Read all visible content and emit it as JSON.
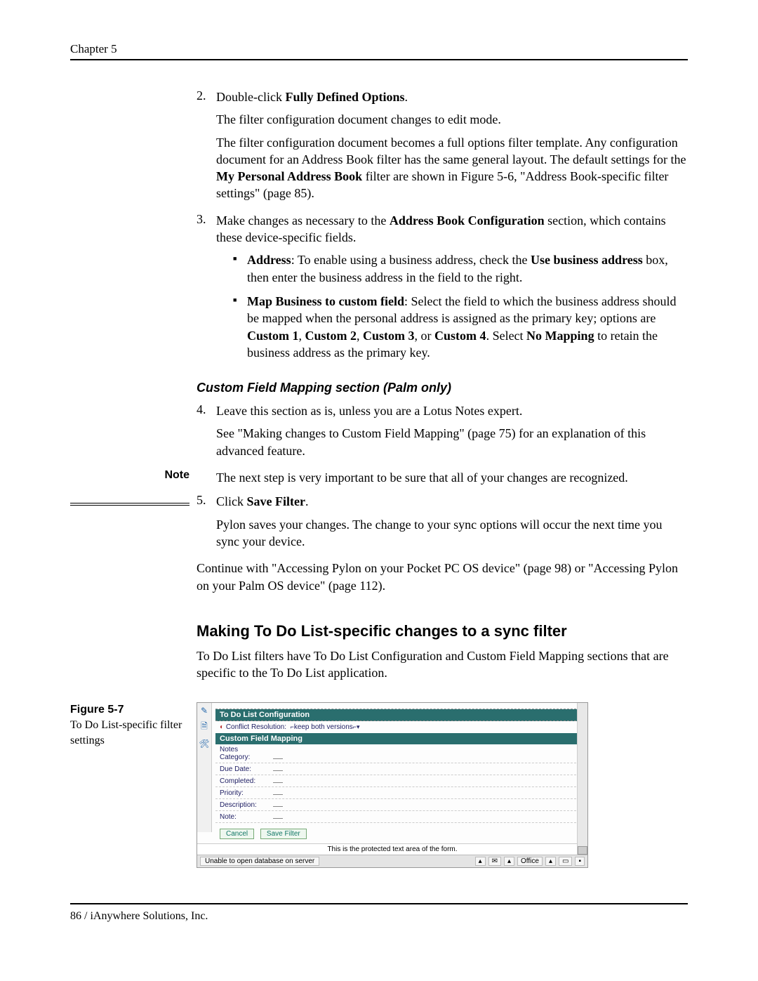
{
  "header": {
    "chapter": "Chapter 5"
  },
  "steps": {
    "s2": {
      "num": "2.",
      "line1a": "Double-click ",
      "line1b": "Fully Defined Options",
      "line1c": ".",
      "p1": "The filter configuration document changes to edit mode.",
      "p2a": "The filter configuration document becomes a full options filter template. Any configuration document for an Address Book filter has the same general layout. The default settings for the ",
      "p2b": "My Personal Address Book",
      "p2c": " filter are shown in Figure 5-6, \"Address Book-specific filter settings\" (page 85)."
    },
    "s3": {
      "num": "3.",
      "line1a": "Make changes as necessary to the ",
      "line1b": "Address Book Configuration",
      "line1c": " section, which contains these device-specific fields.",
      "b1_a": "Address",
      "b1_b": ": To enable using a business address, check the ",
      "b1_c": "Use business address",
      "b1_d": " box, then enter the business address in the field to the right.",
      "b2_a": "Map Business to custom field",
      "b2_b": ": Select the field to which the business address should be mapped when the personal address is assigned as the primary key; options are ",
      "b2_c": "Custom 1",
      "b2_d": ", ",
      "b2_e": "Custom 2",
      "b2_f": ", ",
      "b2_g": "Custom 3",
      "b2_h": ", or ",
      "b2_i": "Custom 4",
      "b2_j": ". Select ",
      "b2_k": "No Mapping",
      "b2_l": " to retain the business address as the primary key."
    },
    "subhead": "Custom Field Mapping section (Palm only)",
    "s4": {
      "num": "4.",
      "line1": "Leave this section as is, unless you are a Lotus Notes expert.",
      "p1": "See \"Making changes to Custom Field Mapping\" (page 75) for an explanation of this advanced feature."
    },
    "note": {
      "label": "Note",
      "text": "The next step is very important to be sure that all of your changes are recognized."
    },
    "s5": {
      "num": "5.",
      "line1a": "Click ",
      "line1b": "Save Filter",
      "line1c": ".",
      "p1": "Pylon saves your changes. The change to your sync options will occur the next time you sync your device."
    },
    "continue": "Continue with \"Accessing Pylon on your Pocket PC OS device\" (page 98) or \"Accessing Pylon on your Palm OS device\" (page 112)."
  },
  "section2": {
    "heading": "Making To Do List-specific changes to a sync filter",
    "intro": "To Do List filters have To Do List Configuration and Custom Field Mapping sections that are specific to the To Do List application."
  },
  "figure": {
    "label": "Figure 5-7",
    "caption": "To Do List-specific filter settings"
  },
  "screenshot": {
    "title": "To Do List Configuration",
    "conflict_label": "Conflict Resolution:",
    "conflict_value": "keep both versions",
    "cfm_title": "Custom Field Mapping",
    "fields": {
      "f0": "Notes Category:",
      "f1": "Due Date:",
      "f2": "Completed:",
      "f3": "Priority:",
      "f4": "Description:",
      "f5": "Note:"
    },
    "cancel": "Cancel",
    "save": "Save Filter",
    "protected": "This is the protected text area of the form.",
    "status_left": "Unable to open database  on server",
    "status_office": "Office"
  },
  "footer": {
    "text": "86  /  iAnywhere Solutions, Inc."
  }
}
